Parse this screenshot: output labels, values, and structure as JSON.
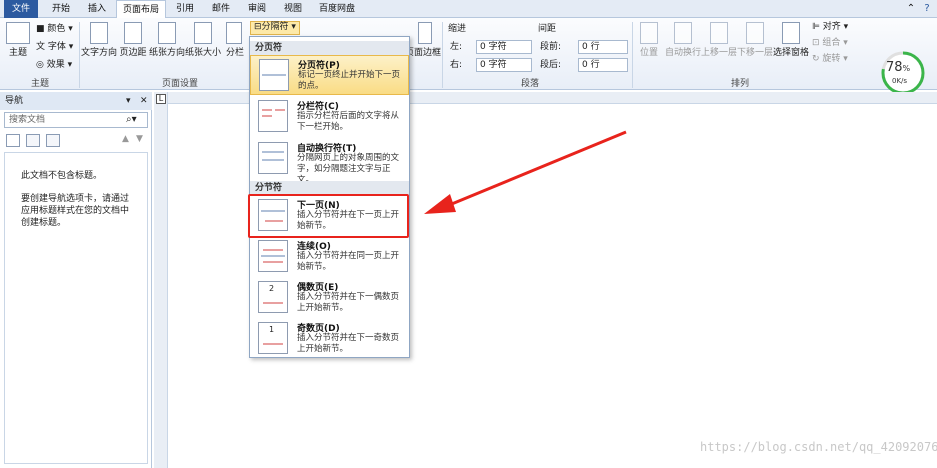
{
  "tabs": [
    "文件",
    "开始",
    "插入",
    "页面布局",
    "引用",
    "邮件",
    "审阅",
    "视图",
    "百度网盘"
  ],
  "ribbon": {
    "theme_group": {
      "label": "主题",
      "btn_theme": "主题",
      "btn_colors": "颜色",
      "btn_fonts": "字体",
      "btn_effects": "效果"
    },
    "page_setup": {
      "label": "页面设置",
      "text_direction": "文字方向",
      "margins": "页边距",
      "orientation": "纸张方向",
      "size": "纸张大小",
      "columns": "分栏",
      "breaks": "分隔符",
      "page_border": "页面边框"
    },
    "paragraph": {
      "label": "段落",
      "indent": "缩进",
      "spacing": "间距",
      "left_label": "左:",
      "right_label": "右:",
      "left_val": "0 字符",
      "right_val": "0 字符",
      "before_label": "段前:",
      "after_label": "段后:",
      "before_val": "0 行",
      "after_val": "0 行"
    },
    "arrange": {
      "label": "排列",
      "position": "位置",
      "wrap": "自动换行",
      "forward": "上移一层",
      "backward": "下移一层",
      "selection_pane": "选择窗格",
      "align": "对齐",
      "group": "组合",
      "rotate": "旋转"
    }
  },
  "gauge": {
    "percent": "78",
    "unit": "%",
    "speed": "0K/s"
  },
  "nav": {
    "title": "导航",
    "search_placeholder": "搜索文档",
    "empty_title": "此文档不包含标题。",
    "empty_hint": "要创建导航选项卡，请通过应用标题样式在您的文档中创建标题。"
  },
  "menu": {
    "section_page": "分页符",
    "section_section": "分节符",
    "items": [
      {
        "title": "分页符(P)",
        "desc": "标记一页终止并开始下一页的点。"
      },
      {
        "title": "分栏符(C)",
        "desc": "指示分栏符后面的文字将从下一栏开始。"
      },
      {
        "title": "自动换行符(T)",
        "desc": "分隔网页上的对象周围的文字，如分隔题注文字与正文。"
      },
      {
        "title": "下一页(N)",
        "desc": "插入分节符并在下一页上开始新节。"
      },
      {
        "title": "连续(O)",
        "desc": "插入分节符并在同一页上开始新节。"
      },
      {
        "title": "偶数页(E)",
        "desc": "插入分节符并在下一偶数页上开始新节。"
      },
      {
        "title": "奇数页(D)",
        "desc": "插入分节符并在下一奇数页上开始新节。"
      }
    ]
  },
  "ruler_left": "L",
  "watermark": "https://blog.csdn.net/qq_42092076",
  "colors": {
    "file_tab": "#2c5aa0",
    "highlight": "#f9dc85",
    "red": "#e8231c",
    "gauge": "#3bb54a"
  }
}
